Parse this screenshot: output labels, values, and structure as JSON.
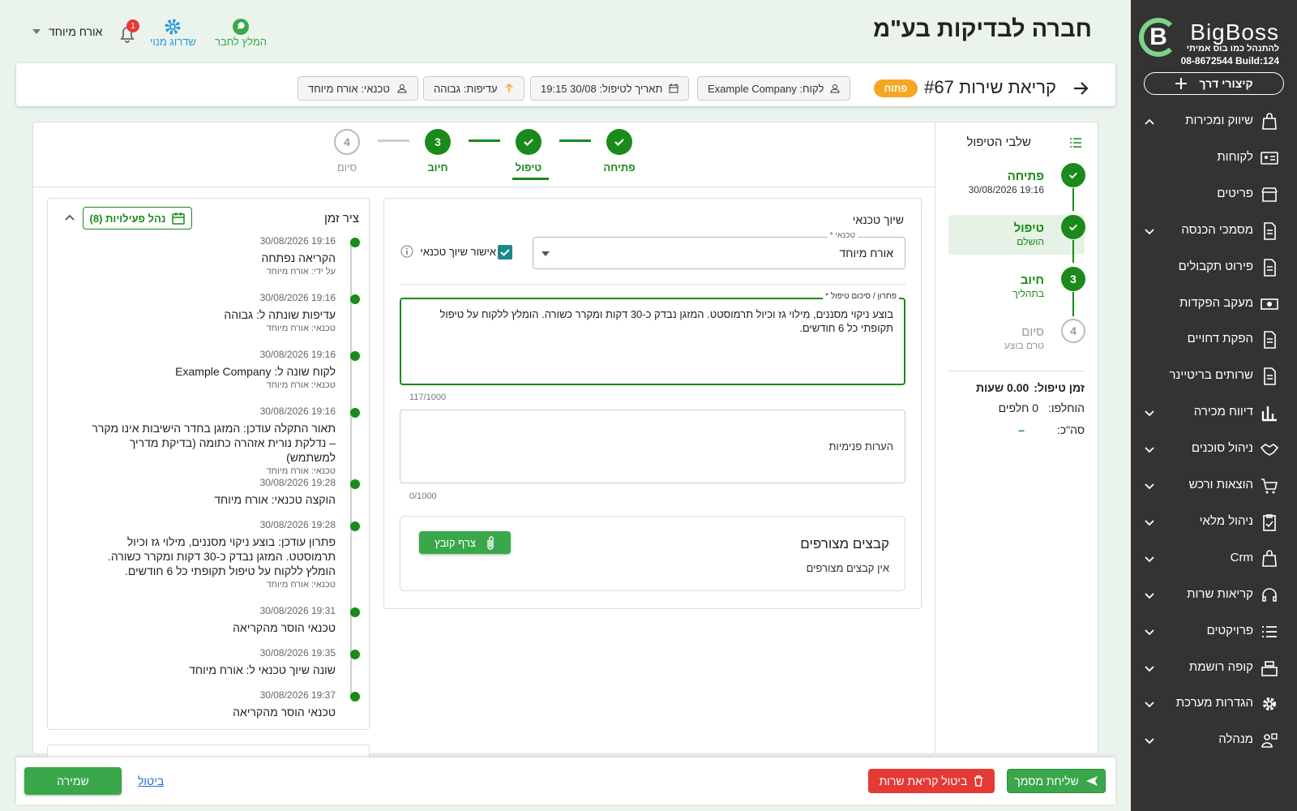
{
  "brand": {
    "name": "BigBoss",
    "tagline": "להתנהל כמו בוס אמיתי",
    "phone": "08-8672544",
    "build": "Build:124",
    "shortcut": "קיצורי דרך"
  },
  "nav": [
    {
      "label": "שיווק ומכירות",
      "icon": "bag-icon",
      "chevron": "up"
    },
    {
      "label": "לקוחות",
      "icon": "id-card-icon",
      "chevron": ""
    },
    {
      "label": "פריטים",
      "icon": "store-icon",
      "chevron": ""
    },
    {
      "label": "מסמכי הכנסה",
      "icon": "document-icon",
      "chevron": "down"
    },
    {
      "label": "פירוט תקבולים",
      "icon": "document-icon",
      "chevron": ""
    },
    {
      "label": "מעקב הפקדות",
      "icon": "cash-icon",
      "chevron": ""
    },
    {
      "label": "הפקת דחויים",
      "icon": "document-icon",
      "chevron": ""
    },
    {
      "label": "שרותים בריטיינר",
      "icon": "document-icon",
      "chevron": ""
    },
    {
      "label": "דיווח מכירה",
      "icon": "chart-icon",
      "chevron": "down"
    },
    {
      "label": "ניהול סוכנים",
      "icon": "handshake-icon",
      "chevron": "down"
    },
    {
      "label": "הוצאות ורכש",
      "icon": "cart-icon",
      "chevron": "down"
    },
    {
      "label": "ניהול מלאי",
      "icon": "clipboard-icon",
      "chevron": "down"
    },
    {
      "label": "Crm",
      "icon": "bag-icon",
      "chevron": "down"
    },
    {
      "label": "קריאות שרות",
      "icon": "headset-icon",
      "chevron": "down"
    },
    {
      "label": "פרויקטים",
      "icon": "list-icon",
      "chevron": "down"
    },
    {
      "label": "קופה רושמת",
      "icon": "register-icon",
      "chevron": "down"
    },
    {
      "label": "הגדרות מערכת",
      "icon": "gear-icon",
      "chevron": "down"
    },
    {
      "label": "מנהלה",
      "icon": "admin-icon",
      "chevron": "down"
    }
  ],
  "header": {
    "company": "חברה לבדיקות בע\"מ",
    "recommend": "המלץ לחבר",
    "upgrade": "שדרוג מנוי",
    "notifications": "1",
    "user": "אורח מיוחד"
  },
  "ticket": {
    "title": "קריאת שירות #67",
    "status": "פתוח",
    "client": "לקוח: Example Company",
    "date": "תאריך לטיפול: 30/08 19:15",
    "priority": "עדיפות: גבוהה",
    "tech": "טכנאי: אורח מיוחד"
  },
  "steps": [
    {
      "label": "פתיחה",
      "num": "",
      "state": "done"
    },
    {
      "label": "טיפול",
      "num": "",
      "state": "done"
    },
    {
      "label": "חיוב",
      "num": "3",
      "state": "current"
    },
    {
      "label": "סיום",
      "num": "4",
      "state": "todo"
    }
  ],
  "stages": {
    "title": "שלבי הטיפול",
    "items": [
      {
        "title": "פתיחה",
        "sub": "19:16 30/08/2026"
      },
      {
        "title": "טיפול",
        "sub": "הושלם"
      },
      {
        "title": "חיוב",
        "sub": "בתהליך",
        "num": "3"
      },
      {
        "title": "סיום",
        "sub": "טרם בוצע",
        "num": "4"
      }
    ],
    "time_label": "זמן טיפול:",
    "time_value": "0.00 שעות",
    "parts_label": "הוחלפו:",
    "parts_value": "0 חלפים",
    "total_label": "סה\"כ:",
    "total_value": "–"
  },
  "assign": {
    "title": "שיוך טכנאי",
    "field_label": "טכנאי *",
    "field_value": "אורח מיוחד",
    "confirm": "אישור שיוך טכנאי",
    "confirmed": true
  },
  "solution": {
    "label": "פתרון / סיכום טיפול *",
    "value": "בוצע ניקוי מסננים, מילוי גז וכיול תרמוסטט. המזגן נבדק כ-30 דקות ומקרר כשורה. הומלץ ללקוח על טיפול תקופתי כל 6 חודשים.",
    "counter": "117/1000"
  },
  "notes": {
    "placeholder": "הערות פנימיות",
    "counter": "0/1000"
  },
  "attachments": {
    "title": "קבצים מצורפים",
    "empty": "אין קבצים מצורפים",
    "button": "צרף קובץ"
  },
  "timeline": {
    "title": "ציר זמן",
    "manage": "נהל פעילויות (8)",
    "events": [
      {
        "time": "19:16 30/08/2026",
        "text": "הקריאה נפתחה",
        "by": "על ידי: אורח מיוחד"
      },
      {
        "time": "19:16 30/08/2026",
        "text": "עדיפות שונתה ל: גבוהה",
        "by": "טכנאי: אורח מיוחד"
      },
      {
        "time": "19:16 30/08/2026",
        "text": "לקוח שונה ל: Example Company",
        "by": "טכנאי: אורח מיוחד"
      },
      {
        "time": "19:16 30/08/2026",
        "text": "תאור התקלה עודכן: המזגן בחדר הישיבות אינו מקרר – נדלקת נורית אזהרה כתומה (בדיקת מדריך למשתמש)",
        "by": "טכנאי: אורח מיוחד"
      },
      {
        "time": "19:28 30/08/2026",
        "text": "הוקצה טכנאי: אורח מיוחד",
        "by": ""
      },
      {
        "time": "19:28 30/08/2026",
        "text": "פתרון עודכן: בוצע ניקוי מסננים, מילוי גז וכיול תרמוסטט. המזגן נבדק כ-30 דקות ומקרר כשורה. הומלץ ללקוח על טיפול תקופתי כל 6 חודשים.",
        "by": "טכנאי: אורח מיוחד"
      },
      {
        "time": "19:31 30/08/2026",
        "text": "טכנאי הוסר מהקריאה",
        "by": ""
      },
      {
        "time": "19:35 30/08/2026",
        "text": "שונה שיוך טכנאי ל: אורח מיוחד",
        "by": ""
      },
      {
        "time": "19:37 30/08/2026",
        "text": "טכנאי הוסר מהקריאה",
        "by": ""
      }
    ]
  },
  "footer": {
    "send": "שליחת מסמך",
    "cancel_call": "ביטול קריאת שרות",
    "cancel": "ביטול",
    "save": "שמירה"
  },
  "colors": {
    "green": "#1a8a1a",
    "sidebar": "#333333",
    "status": "#f5a623",
    "danger": "#e53935"
  }
}
